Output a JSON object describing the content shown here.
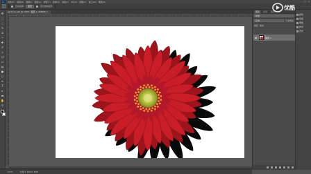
{
  "app": {
    "logo_text": "Ps",
    "menu": [
      "文件(F)",
      "编辑(E)",
      "图像(I)",
      "图层(L)",
      "类型(Y)",
      "选择(S)",
      "滤镜(T)",
      "3D(D)",
      "视图(V)",
      "窗口(W)",
      "帮助(H)"
    ],
    "window_controls": [
      "–",
      "□",
      "×"
    ]
  },
  "options_bar": {
    "auto_select_label": "自动选择",
    "transform_label": "显示变换控件",
    "button_label": "图层"
  },
  "document": {
    "tab_label": "gerbera.psd @ 100% (图层 1, RGB/8) ×",
    "canvas_color": "#ffffff",
    "subject": "red-gerbera-with-drop-shadow"
  },
  "status_bar": {
    "zoom": "100%",
    "doc_info": "文档:1.26M/2.52M"
  },
  "panels": {
    "tabs": [
      "图层",
      "通道",
      "路径"
    ],
    "kind_label": "类型",
    "blend_mode": "正常",
    "opacity_label": "不透明度",
    "lock_label": "锁定",
    "fill_label": "填充",
    "layer_name": "图层 1"
  },
  "side_panel": {
    "items": [
      "颜色",
      "色板",
      "调整",
      "样式",
      "历史"
    ]
  },
  "watermark": {
    "text": "优酷"
  },
  "colors": {
    "petal": "#c91d27",
    "petal_dark": "#9e141c",
    "center": "#a8b23a",
    "stamen": "#e0a030",
    "shadow": "#0a0a0a"
  }
}
